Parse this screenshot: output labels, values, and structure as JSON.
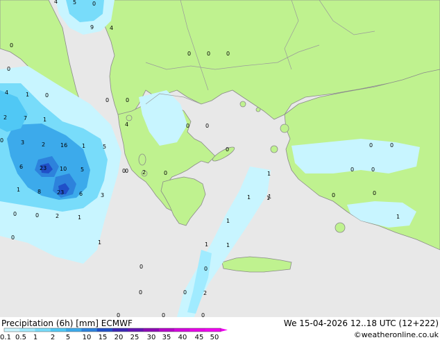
{
  "legend": {
    "title": "Precipitation (6h) [mm] ECMWF",
    "datetime": "We 15-04-2026 12..18 UTC (12+222)",
    "credit": "©weatheronline.co.uk",
    "ticks": [
      "0.1",
      "0.5",
      "1",
      "2",
      "5",
      "10",
      "15",
      "20",
      "25",
      "30",
      "35",
      "40",
      "45",
      "50"
    ],
    "colors": [
      "#c8f5ff",
      "#a0ebff",
      "#78dcfa",
      "#50c8f5",
      "#3caaeb",
      "#2d82dc",
      "#2050c8",
      "#3c28b4",
      "#6414b4",
      "#8c0ab4",
      "#b400c8",
      "#d200dc",
      "#e600e6",
      "#f000f0"
    ]
  },
  "map_colors": {
    "sea": "#e8e8e8",
    "land": "#bff28f",
    "coast": "#8a8a8a",
    "border": "#9a9a9a"
  },
  "point_values": [
    {
      "v": "4"
    },
    {
      "v": "5"
    },
    {
      "v": "0"
    },
    {
      "v": "9"
    },
    {
      "v": "4"
    },
    {
      "v": "0"
    },
    {
      "v": "0"
    },
    {
      "v": "0"
    },
    {
      "v": "0"
    },
    {
      "v": "0"
    },
    {
      "v": "4"
    },
    {
      "v": "1"
    },
    {
      "v": "0"
    },
    {
      "v": "2"
    },
    {
      "v": "7"
    },
    {
      "v": "1"
    },
    {
      "v": "0"
    },
    {
      "v": "0"
    },
    {
      "v": "4"
    },
    {
      "v": "0"
    },
    {
      "v": "3"
    },
    {
      "v": "2"
    },
    {
      "v": "16"
    },
    {
      "v": "1"
    },
    {
      "v": "5"
    },
    {
      "v": "0"
    },
    {
      "v": "0"
    },
    {
      "v": "0"
    },
    {
      "v": "6"
    },
    {
      "v": "23"
    },
    {
      "v": "10"
    },
    {
      "v": "5"
    },
    {
      "v": "0"
    },
    {
      "v": "2"
    },
    {
      "v": "0"
    },
    {
      "v": "1"
    },
    {
      "v": "8"
    },
    {
      "v": "23"
    },
    {
      "v": "6"
    },
    {
      "v": "3"
    },
    {
      "v": "1"
    },
    {
      "v": "0"
    },
    {
      "v": "0"
    },
    {
      "v": "2"
    },
    {
      "v": "0"
    },
    {
      "v": "0"
    },
    {
      "v": "1"
    },
    {
      "v": "1"
    },
    {
      "v": "1"
    },
    {
      "v": "1"
    },
    {
      "v": "1"
    },
    {
      "v": "0"
    },
    {
      "v": "0"
    },
    {
      "v": "0"
    },
    {
      "v": "0"
    },
    {
      "v": "0"
    },
    {
      "v": "0"
    },
    {
      "v": "0"
    },
    {
      "v": "1"
    },
    {
      "v": "1"
    },
    {
      "v": "0"
    },
    {
      "v": "1"
    },
    {
      "v": "1"
    },
    {
      "v": "0"
    },
    {
      "v": "0"
    },
    {
      "v": "0"
    },
    {
      "v": "0"
    },
    {
      "v": "0"
    },
    {
      "v": "2"
    }
  ]
}
